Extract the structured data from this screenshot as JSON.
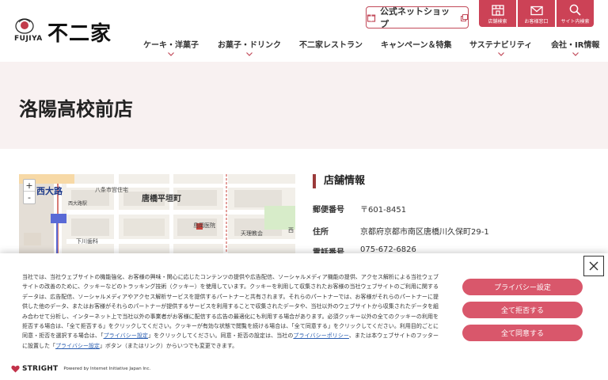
{
  "header": {
    "logo_en": "FUJIYA",
    "logo_jp": "不二家",
    "shop_button_label": "公式ネットショップ",
    "utility": [
      {
        "label": "店舗検索",
        "icon": "store-icon"
      },
      {
        "label": "お客様窓口",
        "icon": "mail-icon"
      },
      {
        "label": "サイト内検索",
        "icon": "search-icon"
      }
    ],
    "nav": [
      {
        "label": "ケーキ・洋菓子",
        "has_dropdown": true
      },
      {
        "label": "お菓子・ドリンク",
        "has_dropdown": true
      },
      {
        "label": "不二家レストラン",
        "has_dropdown": false
      },
      {
        "label": "キャンペーン＆特集",
        "has_dropdown": false
      },
      {
        "label": "サステナビリティ",
        "has_dropdown": true
      },
      {
        "label": "会社・IR情報",
        "has_dropdown": true
      }
    ]
  },
  "page": {
    "title": "洛陽高校前店"
  },
  "map": {
    "labels": {
      "station": "西大路",
      "office": "八条市営住宅",
      "area": "唐橋平垣町",
      "hospital": "島岡医院",
      "place1": "下川歯科",
      "place2": "天理教会",
      "place3": "西大路駅",
      "edge": "西"
    },
    "zoom_in": "+",
    "zoom_out": "-"
  },
  "store_info": {
    "heading": "店舗情報",
    "rows": [
      {
        "key": "郵便番号",
        "value": "〒601-8451"
      },
      {
        "key": "住所",
        "value": "京都府京都市南区唐橋川久保町29-1"
      },
      {
        "key": "電話番号",
        "value": "075-672-6826"
      }
    ]
  },
  "cookie": {
    "text_part1": "当社では、当社ウェブサイトの機能強化、お客様の興味・関心に応じたコンテンツの提供や広告配信、ソーシャルメディア機能の提供、アクセス解析による当社ウェブサイトの改善のために、クッキーなどのトラッキング技術（クッキー）を使用しています。クッキーを利用して収集されたお客様の当社ウェブサイトのご利用に関するデータは、広告配信、ソーシャルメディアやアクセス解析サービスを提供するパートナーと共有されます。それらのパートナーでは、お客様がそれらのパートナーに提供した他のデータ、またはお客様がそれらのパートナーが提供するサービスを利用することで収集されたデータや、当社以外のウェブサイトから収集されたデータを組み合わせて分析し、インターネット上で当社以外の事業者がお客様に配信する広告の最適化にも利用する場合があります。必須クッキー以外の全てのクッキーの利用を拒否する場合は、「全て拒否する」をクリックしてください。クッキーが有効な状態で閲覧を続ける場合は、「全て同意する」をクリックしてください。利用目的ごとに同意・拒否を選択する場合は、「",
    "link_settings": "プライバシー設定",
    "text_part2": "」をクリックしてください。同意・拒否の設定は、当社の",
    "link_policy": "プライバシーポリシー",
    "text_part3": "、または本ウェブサイトのフッターに設置した「",
    "link_settings2": "プライバシー設定",
    "text_part4": "」ボタン（またはリンク）からいつでも変更できます。",
    "buttons": {
      "settings": "プライバシー設定",
      "reject_all": "全て拒否する",
      "accept_all": "全て同意する"
    },
    "footer_brand": "STRIGHT",
    "footer_powered": "Powered by Internet Initiative Japan Inc.",
    "accent_color": "#d9576b"
  }
}
